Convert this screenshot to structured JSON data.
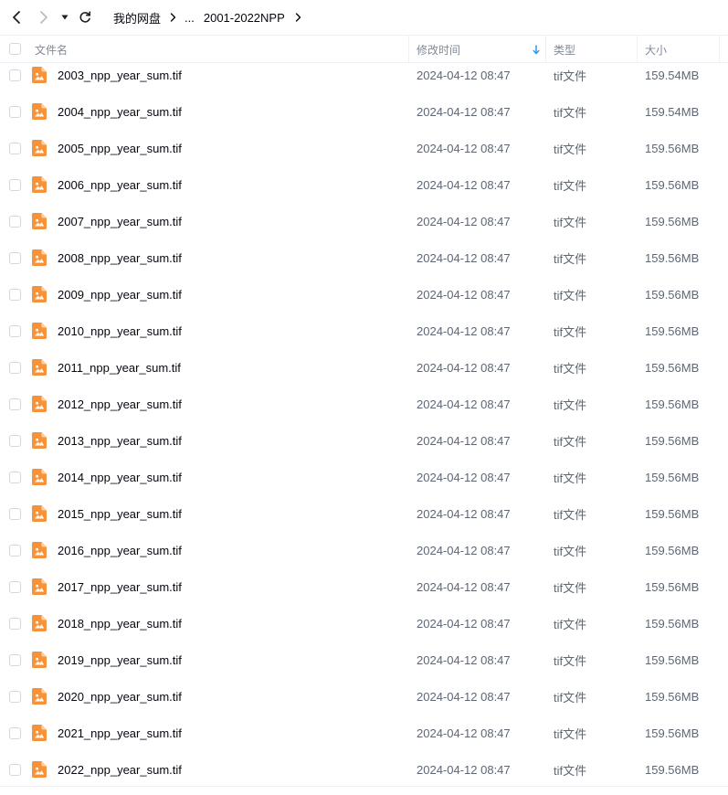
{
  "toolbar": {
    "back_icon": "chevron-left-icon",
    "forward_icon": "chevron-right-icon",
    "dropdown_icon": "caret-down-icon",
    "refresh_icon": "refresh-icon",
    "breadcrumb": [
      "我的网盘",
      "...",
      "2001-2022NPP"
    ]
  },
  "columns": {
    "name": "文件名",
    "modified": "修改时间",
    "type": "类型",
    "size": "大小",
    "sort_icon": "sort-down-arrow-icon",
    "sort_color": "#2b9cf2"
  },
  "file_icon": "image-file-icon",
  "file_icon_color": "#f7923a",
  "files": [
    {
      "name": "2003_npp_year_sum.tif",
      "modified": "2024-04-12 08:47",
      "type": "tif文件",
      "size": "159.54MB"
    },
    {
      "name": "2004_npp_year_sum.tif",
      "modified": "2024-04-12 08:47",
      "type": "tif文件",
      "size": "159.54MB"
    },
    {
      "name": "2005_npp_year_sum.tif",
      "modified": "2024-04-12 08:47",
      "type": "tif文件",
      "size": "159.56MB"
    },
    {
      "name": "2006_npp_year_sum.tif",
      "modified": "2024-04-12 08:47",
      "type": "tif文件",
      "size": "159.56MB"
    },
    {
      "name": "2007_npp_year_sum.tif",
      "modified": "2024-04-12 08:47",
      "type": "tif文件",
      "size": "159.56MB"
    },
    {
      "name": "2008_npp_year_sum.tif",
      "modified": "2024-04-12 08:47",
      "type": "tif文件",
      "size": "159.56MB"
    },
    {
      "name": "2009_npp_year_sum.tif",
      "modified": "2024-04-12 08:47",
      "type": "tif文件",
      "size": "159.56MB"
    },
    {
      "name": "2010_npp_year_sum.tif",
      "modified": "2024-04-12 08:47",
      "type": "tif文件",
      "size": "159.56MB"
    },
    {
      "name": "2011_npp_year_sum.tif",
      "modified": "2024-04-12 08:47",
      "type": "tif文件",
      "size": "159.56MB"
    },
    {
      "name": "2012_npp_year_sum.tif",
      "modified": "2024-04-12 08:47",
      "type": "tif文件",
      "size": "159.56MB"
    },
    {
      "name": "2013_npp_year_sum.tif",
      "modified": "2024-04-12 08:47",
      "type": "tif文件",
      "size": "159.56MB"
    },
    {
      "name": "2014_npp_year_sum.tif",
      "modified": "2024-04-12 08:47",
      "type": "tif文件",
      "size": "159.56MB"
    },
    {
      "name": "2015_npp_year_sum.tif",
      "modified": "2024-04-12 08:47",
      "type": "tif文件",
      "size": "159.56MB"
    },
    {
      "name": "2016_npp_year_sum.tif",
      "modified": "2024-04-12 08:47",
      "type": "tif文件",
      "size": "159.56MB"
    },
    {
      "name": "2017_npp_year_sum.tif",
      "modified": "2024-04-12 08:47",
      "type": "tif文件",
      "size": "159.56MB"
    },
    {
      "name": "2018_npp_year_sum.tif",
      "modified": "2024-04-12 08:47",
      "type": "tif文件",
      "size": "159.56MB"
    },
    {
      "name": "2019_npp_year_sum.tif",
      "modified": "2024-04-12 08:47",
      "type": "tif文件",
      "size": "159.56MB"
    },
    {
      "name": "2020_npp_year_sum.tif",
      "modified": "2024-04-12 08:47",
      "type": "tif文件",
      "size": "159.56MB"
    },
    {
      "name": "2021_npp_year_sum.tif",
      "modified": "2024-04-12 08:47",
      "type": "tif文件",
      "size": "159.56MB"
    },
    {
      "name": "2022_npp_year_sum.tif",
      "modified": "2024-04-12 08:47",
      "type": "tif文件",
      "size": "159.56MB"
    }
  ]
}
